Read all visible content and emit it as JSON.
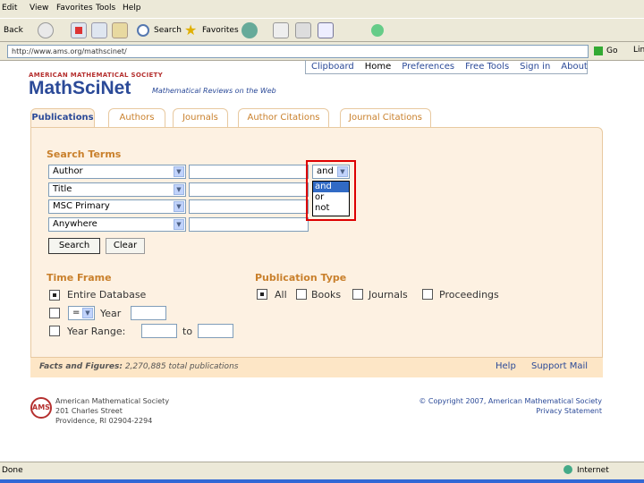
{
  "menu": [
    "Edit",
    "View",
    "Favorites",
    "Tools",
    "Help"
  ],
  "toolbar": {
    "back": "Back",
    "search": "Search",
    "favorites": "Favorites"
  },
  "address": {
    "url": "http://www.ams.org/mathscinet/",
    "go": "Go",
    "links": "Links"
  },
  "header": {
    "society": "AMERICAN MATHEMATICAL SOCIETY",
    "logo": "MathSciNet",
    "tagline": "Mathematical Reviews on the Web"
  },
  "topnav": [
    "Clipboard",
    "Home",
    "Preferences",
    "Free Tools",
    "Sign in",
    "About"
  ],
  "tabs": [
    "Publications",
    "Authors",
    "Journals",
    "Author Citations",
    "Journal Citations"
  ],
  "search": {
    "title": "Search Terms",
    "fields": [
      "Author",
      "Title",
      "MSC Primary",
      "Anywhere"
    ],
    "operator": "and",
    "operator_options": [
      "and",
      "or",
      "not"
    ],
    "search_button": "Search",
    "clear_button": "Clear"
  },
  "timeframe": {
    "title": "Time Frame",
    "entire": "Entire Database",
    "op": "=",
    "year_label": "Year",
    "range_label": "Year Range:",
    "to_label": "to"
  },
  "pubtype": {
    "title": "Publication Type",
    "options": [
      "All",
      "Books",
      "Journals",
      "Proceedings"
    ]
  },
  "footer": {
    "facts_label": "Facts and Figures:",
    "facts_value": "2,270,885 total publications",
    "help": "Help",
    "support": "Support Mail"
  },
  "bottom": {
    "seal": "AMS",
    "address": [
      "American Mathematical Society",
      "201 Charles Street",
      "Providence, RI 02904-2294"
    ],
    "copyright": "© Copyright 2007, American Mathematical Society",
    "privacy": "Privacy Statement"
  },
  "status": {
    "left": "Done",
    "zone": "Internet"
  }
}
